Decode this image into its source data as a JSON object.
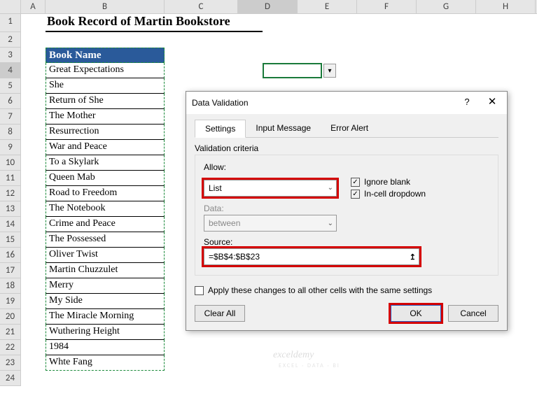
{
  "columns": [
    "A",
    "B",
    "C",
    "D",
    "E",
    "F",
    "G",
    "H"
  ],
  "rows": [
    "1",
    "2",
    "3",
    "4",
    "5",
    "6",
    "7",
    "8",
    "9",
    "10",
    "11",
    "12",
    "13",
    "14",
    "15",
    "16",
    "17",
    "18",
    "19",
    "20",
    "21",
    "22",
    "23",
    "24"
  ],
  "title": "Book Record of Martin Bookstore",
  "table_header": "Book Name",
  "books": [
    "Great Expectations",
    "She",
    "Return of She",
    "The Mother",
    "Resurrection",
    "War and Peace",
    "To a Skylark",
    "Queen Mab",
    "Road to Freedom",
    "The Notebook",
    "Crime and Peace",
    "The Possessed",
    "Oliver Twist",
    "Martin Chuzzulet",
    "Merry",
    "My Side",
    "The Miracle Morning",
    "Wuthering Height",
    "1984",
    "Whte Fang"
  ],
  "dialog": {
    "title": "Data Validation",
    "tabs": {
      "settings": "Settings",
      "input_message": "Input Message",
      "error_alert": "Error Alert"
    },
    "criteria_label": "Validation criteria",
    "allow_label": "Allow:",
    "allow_value": "List",
    "ignore_blank": "Ignore blank",
    "in_cell_dropdown": "In-cell dropdown",
    "data_label": "Data:",
    "data_value": "between",
    "source_label": "Source:",
    "source_value": "=$B$4:$B$23",
    "apply_text": "Apply these changes to all other cells with the same settings",
    "clear_all": "Clear All",
    "ok": "OK",
    "cancel": "Cancel",
    "help": "?",
    "close": "✕"
  },
  "dropdown_glyph": "▾",
  "chev_glyph": "⌄",
  "collapse_glyph": "↥",
  "check_glyph": "✓",
  "watermark": "exceldemy",
  "watermark_sub": "EXCEL · DATA · BI",
  "chart_data": null
}
